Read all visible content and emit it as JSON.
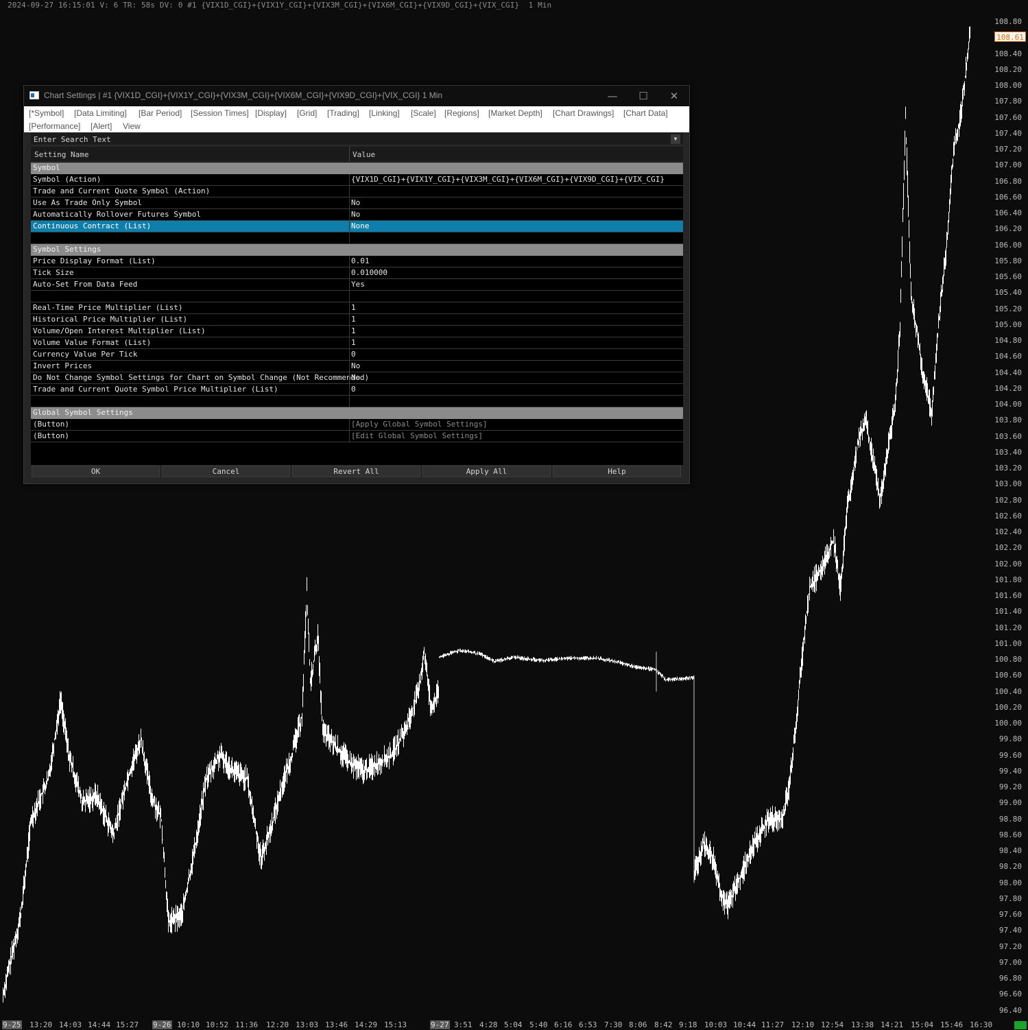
{
  "chart": {
    "header": "2024-09-27 16:15:01 V: 6 TR: 58s DV: 0 #1 {VIX1D_CGI}+{VIX1Y_CGI}+{VIX3M_CGI}+{VIX6M_CGI}+{VIX9D_CGI}+{VIX_CGI}  1 Min",
    "last_price": "108.61",
    "price_axis": [
      "108.80",
      "108.40",
      "108.20",
      "108.00",
      "107.80",
      "107.60",
      "107.40",
      "107.20",
      "107.00",
      "106.80",
      "106.60",
      "106.40",
      "106.20",
      "106.00",
      "105.80",
      "105.60",
      "105.40",
      "105.20",
      "105.00",
      "104.80",
      "104.60",
      "104.40",
      "104.20",
      "104.00",
      "103.80",
      "103.60",
      "103.40",
      "103.20",
      "103.00",
      "102.80",
      "102.60",
      "102.40",
      "102.20",
      "102.00",
      "101.80",
      "101.60",
      "101.40",
      "101.20",
      "101.00",
      "100.80",
      "100.60",
      "100.40",
      "100.20",
      "100.00",
      "99.80",
      "99.60",
      "99.40",
      "99.20",
      "99.00",
      "98.80",
      "98.60",
      "98.40",
      "98.20",
      "98.00",
      "97.80",
      "97.60",
      "97.40",
      "97.20",
      "97.00",
      "96.80",
      "96.60",
      "96.40"
    ],
    "time_axis": [
      {
        "label": "9-25",
        "date": true
      },
      {
        "label": "13:20"
      },
      {
        "label": "14:03"
      },
      {
        "label": "14:44"
      },
      {
        "label": "15:27"
      },
      {
        "label": "9-26",
        "date": true
      },
      {
        "label": "10:10"
      },
      {
        "label": "10:52"
      },
      {
        "label": "11:36"
      },
      {
        "label": "12:20"
      },
      {
        "label": "13:03"
      },
      {
        "label": "13:46"
      },
      {
        "label": "14:29"
      },
      {
        "label": "15:13"
      },
      {
        "label": "9-27",
        "date": true
      },
      {
        "label": "3:51"
      },
      {
        "label": "4:28"
      },
      {
        "label": "5:04"
      },
      {
        "label": "5:40"
      },
      {
        "label": "6:16"
      },
      {
        "label": "6:53"
      },
      {
        "label": "7:30"
      },
      {
        "label": "8:06"
      },
      {
        "label": "8:42"
      },
      {
        "label": "9:18"
      },
      {
        "label": "10:03"
      },
      {
        "label": "10:44"
      },
      {
        "label": "11:27"
      },
      {
        "label": "12:10"
      },
      {
        "label": "12:54"
      },
      {
        "label": "13:38"
      },
      {
        "label": "14:21"
      },
      {
        "label": "15:04"
      },
      {
        "label": "15:46"
      },
      {
        "label": "16:30"
      }
    ],
    "colors": {
      "background": "#0c0c0c",
      "bars": "#ffffff",
      "last_price_text": "#e07000",
      "status": "#17a52b"
    }
  },
  "dialog": {
    "title": "Chart Settings | #1 {VIX1D_CGI}+{VIX1Y_CGI}+{VIX3M_CGI}+{VIX6M_CGI}+{VIX9D_CGI}+{VIX_CGI}  1 Min",
    "icons": {
      "minimize": "minimize-icon",
      "maximize": "maximize-icon",
      "close": "close-icon"
    },
    "tabs_row1": [
      "[*Symbol]",
      "[Data Limiting]",
      "[Bar Period]",
      "[Session Times]",
      "[Display]",
      "[Grid]",
      "[Trading]",
      "[Linking]",
      "[Scale]",
      "[Regions]",
      "[Market Depth]",
      "[Chart Drawings]",
      "[Chart Data]"
    ],
    "tabs_row2": [
      "[Performance]",
      "[Alert]",
      "View"
    ],
    "search": {
      "placeholder": "Enter Search Text"
    },
    "grid": {
      "col_name": "Setting Name",
      "col_value": "Value",
      "rows": [
        {
          "type": "section",
          "name": "Symbol"
        },
        {
          "name": "Symbol (Action)",
          "value": "{VIX1D_CGI}+{VIX1Y_CGI}+{VIX3M_CGI}+{VIX6M_CGI}+{VIX9D_CGI}+{VIX_CGI}"
        },
        {
          "name": "Trade and Current Quote Symbol (Action)",
          "value": ""
        },
        {
          "name": "Use As Trade Only Symbol",
          "value": "No"
        },
        {
          "name": "Automatically Rollover Futures Symbol",
          "value": "No"
        },
        {
          "name": "Continuous Contract (List)",
          "value": "None",
          "selected": true
        },
        {
          "type": "blank"
        },
        {
          "type": "section",
          "name": "Symbol Settings"
        },
        {
          "name": "Price Display Format (List)",
          "value": "0.01"
        },
        {
          "name": "Tick Size",
          "value": "0.010000"
        },
        {
          "name": "Auto-Set From Data Feed",
          "value": "Yes"
        },
        {
          "type": "blank"
        },
        {
          "name": "Real-Time Price Multiplier (List)",
          "value": "1"
        },
        {
          "name": "Historical Price Multiplier (List)",
          "value": "1"
        },
        {
          "name": "Volume/Open Interest Multiplier (List)",
          "value": "1"
        },
        {
          "name": "Volume Value Format (List)",
          "value": "1"
        },
        {
          "name": "Currency Value Per Tick",
          "value": "0"
        },
        {
          "name": "Invert Prices",
          "value": "No"
        },
        {
          "name": "Do Not Change Symbol Settings for Chart on Symbol Change (Not Recommended)",
          "value": "No"
        },
        {
          "name": "Trade and Current Quote Symbol Price Multiplier (List)",
          "value": "0"
        },
        {
          "type": "blank"
        },
        {
          "type": "section",
          "name": "Global Symbol Settings"
        },
        {
          "name": " (Button)",
          "value": "[Apply Global Symbol Settings]",
          "dim": true
        },
        {
          "name": " (Button)",
          "value": "[Edit Global Symbol Settings]",
          "dim": true
        }
      ]
    },
    "buttons": [
      "OK",
      "Cancel",
      "Revert All",
      "Apply All",
      "Help"
    ]
  }
}
